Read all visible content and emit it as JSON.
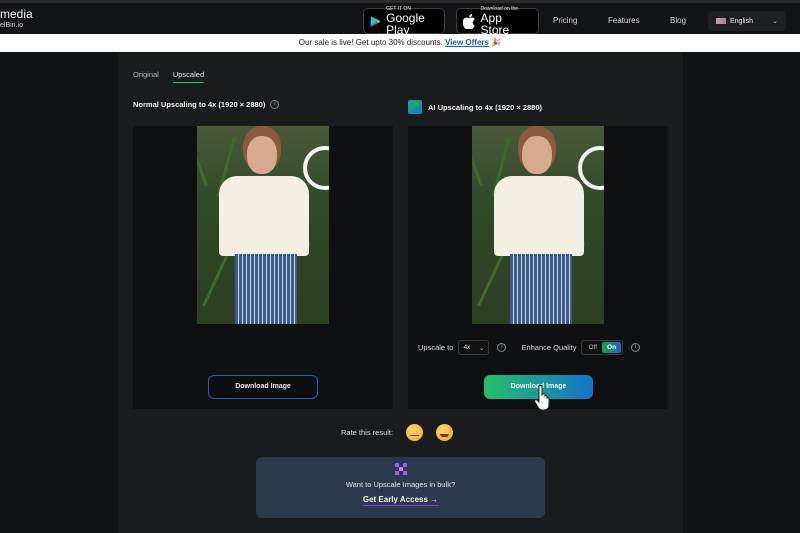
{
  "header": {
    "brand_name": "media",
    "brand_sub": "elBin.io",
    "google_play": {
      "small": "GET IT ON",
      "big": "Google Play"
    },
    "app_store": {
      "small": "Download on the",
      "big": "App Store"
    },
    "nav": [
      "Pricing",
      "Features",
      "Blog"
    ],
    "language": "English"
  },
  "banner": {
    "text": "Our sale is live! Get upto 30% discounts.",
    "link": "View Offers",
    "emoji": "🎉"
  },
  "tabs": [
    {
      "label": "Original",
      "active": false
    },
    {
      "label": "Upscaled",
      "active": true
    }
  ],
  "normal": {
    "title": "Normal Upscaling to 4x (1920 × 2880)",
    "download_label": "Download Image"
  },
  "ai": {
    "title": "AI Upscaling to 4x (1920 × 2880)",
    "upscale_label": "Upscale to",
    "upscale_value": "4x",
    "enhance_label": "Enhance Quality",
    "toggle_off": "Off",
    "toggle_on": "On",
    "enhance_state": "On",
    "download_label": "Download Image"
  },
  "rating": {
    "label": "Rate this result:",
    "options": [
      "unamused-face",
      "grinning-face"
    ]
  },
  "bulk": {
    "question": "Want to Upscale Images in bulk?",
    "cta": "Get Early Access",
    "arrow": "→"
  },
  "colors": {
    "accent_green": "#22c06a",
    "accent_blue": "#1573c8",
    "link_blue": "#1e5fb0",
    "purple": "#a855f7"
  }
}
